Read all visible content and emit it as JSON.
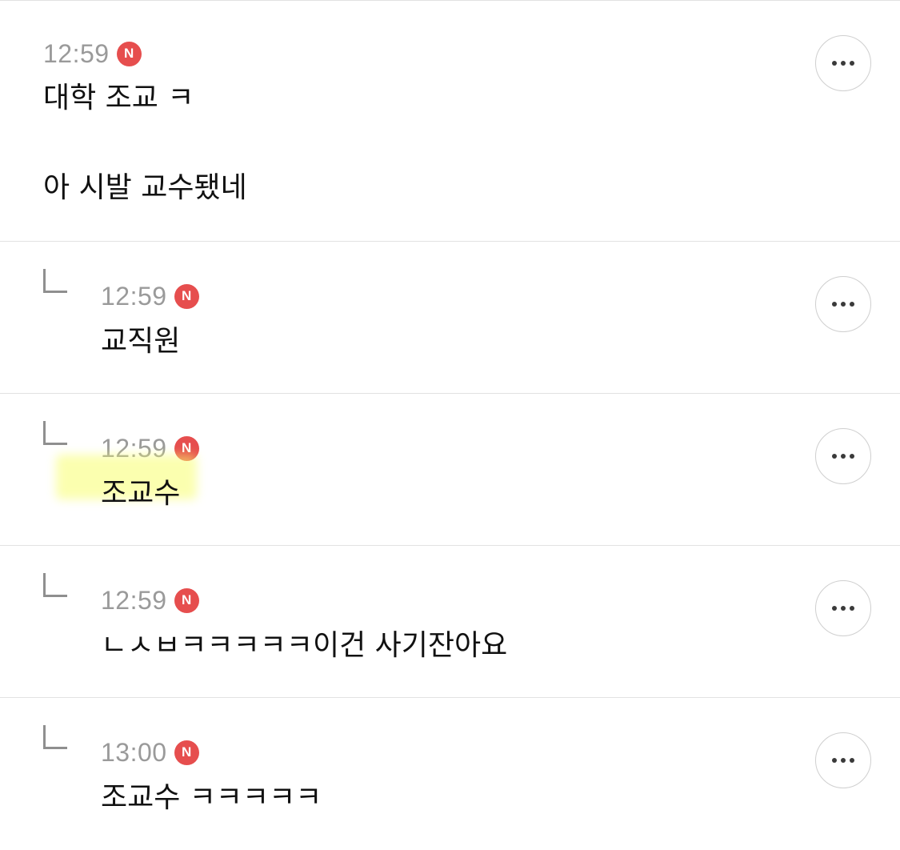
{
  "comments": [
    {
      "time": "12:59",
      "badge": "N",
      "text": "대학 조교 ㅋ\n\n아 시발 교수됐네"
    },
    {
      "time": "12:59",
      "badge": "N",
      "text": "교직원"
    },
    {
      "time": "12:59",
      "badge": "N",
      "text": "조교수"
    },
    {
      "time": "12:59",
      "badge": "N",
      "text": "ㄴㅅㅂㅋㅋㅋㅋㅋ이건 사기잔아요"
    },
    {
      "time": "13:00",
      "badge": "N",
      "text": "조교수 ㅋㅋㅋㅋㅋ"
    }
  ],
  "colors": {
    "badge": "#e64e4e",
    "highlight": "#f8ff6e",
    "time": "#9a9a9a",
    "divider": "#e2e2e2"
  },
  "icons": {
    "reply": "reply-arrow-icon",
    "more": "more-dots-icon"
  }
}
